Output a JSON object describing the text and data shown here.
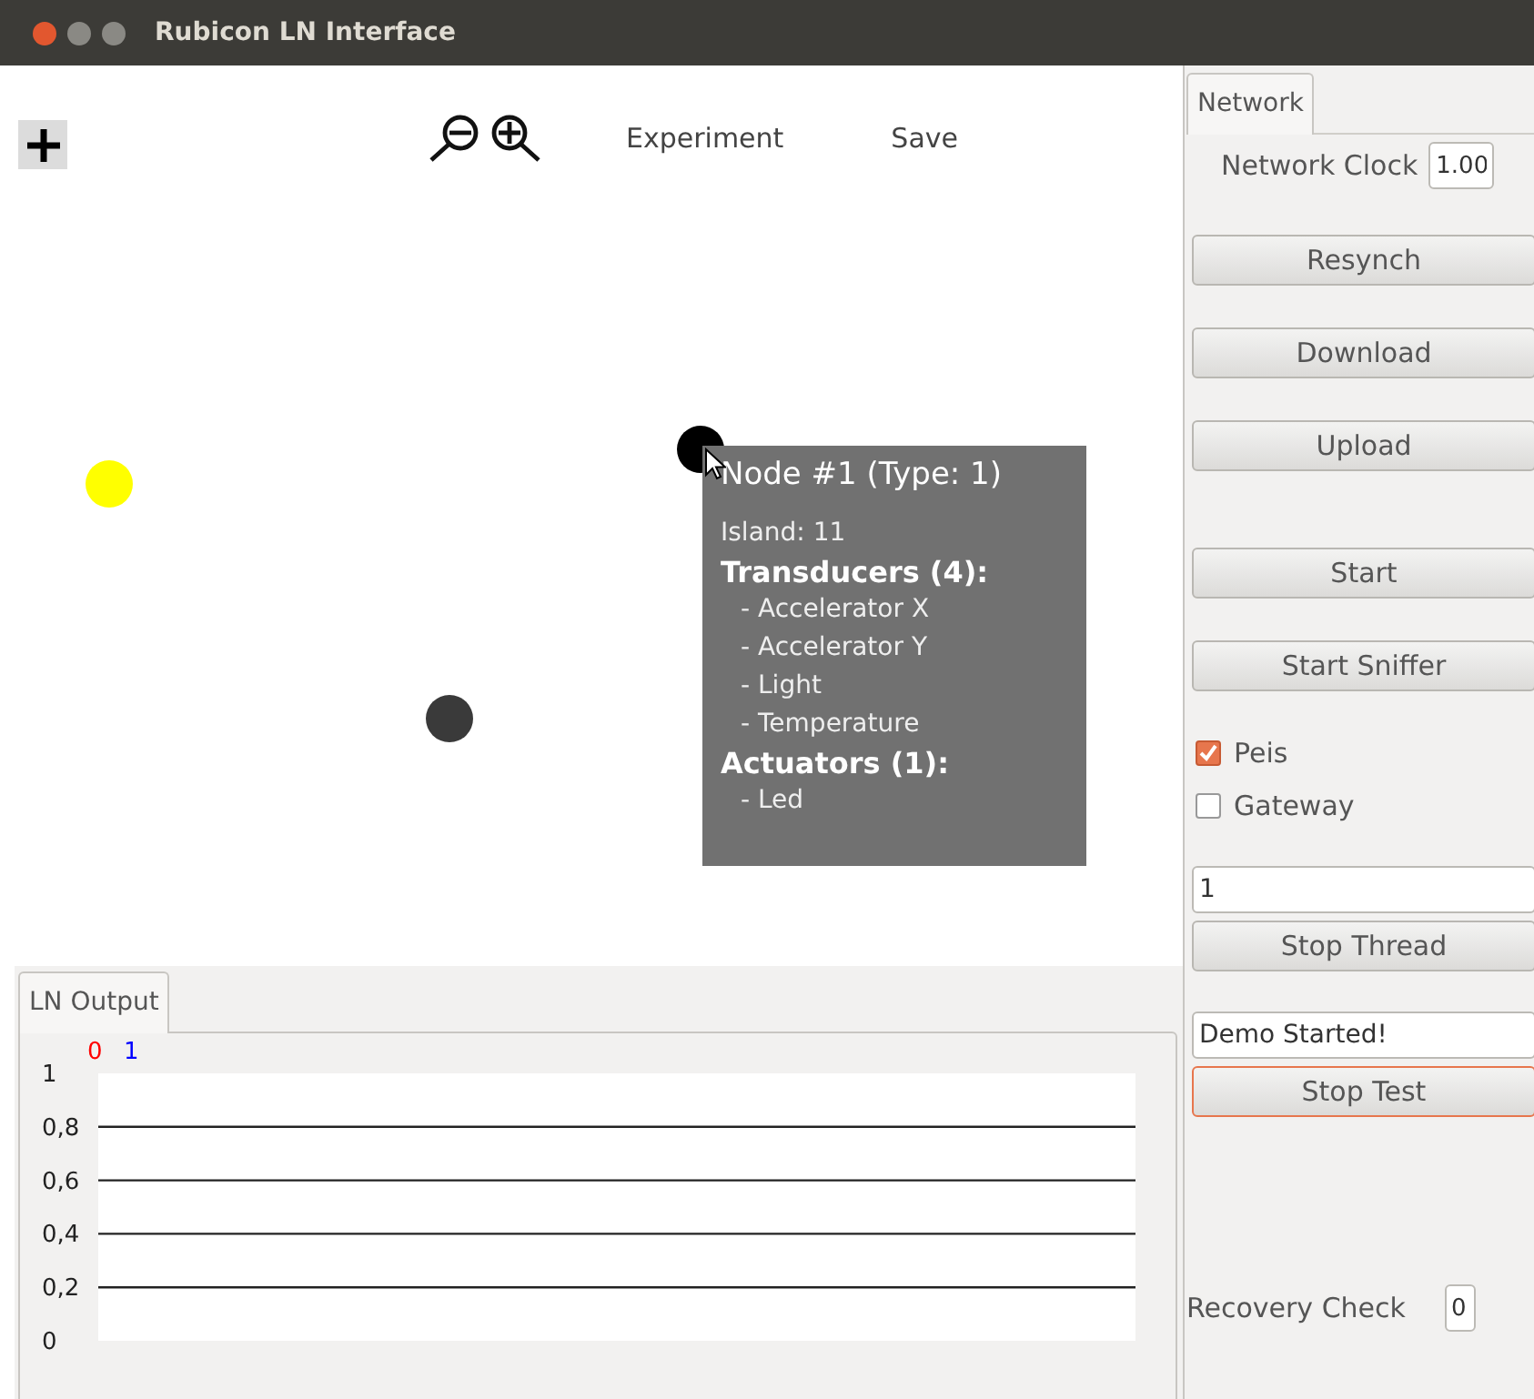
{
  "window": {
    "title": "Rubicon LN Interface"
  },
  "toolbar": {
    "items": [
      {
        "kind": "zoom-out"
      },
      {
        "kind": "zoom-in"
      },
      {
        "kind": "text",
        "label": "Experiment"
      },
      {
        "kind": "text",
        "label": "Save"
      }
    ]
  },
  "canvas": {
    "nodes": [
      {
        "color": "#ffff00",
        "hovered": false
      },
      {
        "color": "#3a3a3a",
        "hovered": false
      },
      {
        "color": "#000000",
        "hovered": true
      }
    ],
    "tooltip": {
      "title": "Node #1 (Type: 1)",
      "lines": [
        {
          "kind": "info",
          "text": "Island: 11"
        },
        {
          "kind": "heading",
          "text": "Transducers (4):"
        },
        {
          "kind": "item",
          "text": "- Accelerator X"
        },
        {
          "kind": "item",
          "text": "- Accelerator Y"
        },
        {
          "kind": "item",
          "text": "- Light"
        },
        {
          "kind": "item",
          "text": "- Temperature"
        },
        {
          "kind": "heading",
          "text": "Actuators (1):"
        },
        {
          "kind": "item",
          "text": "- Led"
        }
      ]
    }
  },
  "output_panel": {
    "tabs": [
      {
        "label": "LN Output",
        "selected": true
      }
    ],
    "chart_data": {
      "type": "line",
      "grid": true,
      "series": [
        {
          "name": "0",
          "color": "#ff0000"
        },
        {
          "name": "1",
          "color": "#0000ff"
        }
      ],
      "ylim": [
        0,
        1
      ],
      "yticks": [
        {
          "value": 1,
          "label": "1"
        },
        {
          "value": 0.8,
          "label": "0,8"
        },
        {
          "value": 0.6,
          "label": "0,6"
        },
        {
          "value": 0.4,
          "label": "0,4"
        },
        {
          "value": 0.2,
          "label": "0,2"
        },
        {
          "value": 0,
          "label": "0"
        }
      ]
    }
  },
  "side_panel": {
    "tabs": [
      {
        "label": "Network",
        "selected": true
      }
    ],
    "controls": [
      {
        "kind": "labeled-field",
        "label": "Network Clock",
        "value": "1.00"
      },
      {
        "kind": "button",
        "label": "Resynch",
        "focused": false
      },
      {
        "kind": "button",
        "label": "Download",
        "focused": false
      },
      {
        "kind": "button",
        "label": "Upload",
        "focused": false
      },
      {
        "kind": "spacer"
      },
      {
        "kind": "button",
        "label": "Start",
        "focused": false
      },
      {
        "kind": "button",
        "label": "Start Sniffer",
        "focused": false
      },
      {
        "kind": "checkbox",
        "label": "Peis",
        "checked": true
      },
      {
        "kind": "checkbox",
        "label": "Gateway",
        "checked": false
      },
      {
        "kind": "field",
        "value": "1"
      },
      {
        "kind": "button",
        "label": "Stop Thread",
        "focused": false
      },
      {
        "kind": "field",
        "value": "Demo Started!"
      },
      {
        "kind": "button",
        "label": "Stop Test",
        "focused": true
      },
      {
        "kind": "labeled-field",
        "label": "Recovery Check",
        "value": "0"
      }
    ]
  }
}
